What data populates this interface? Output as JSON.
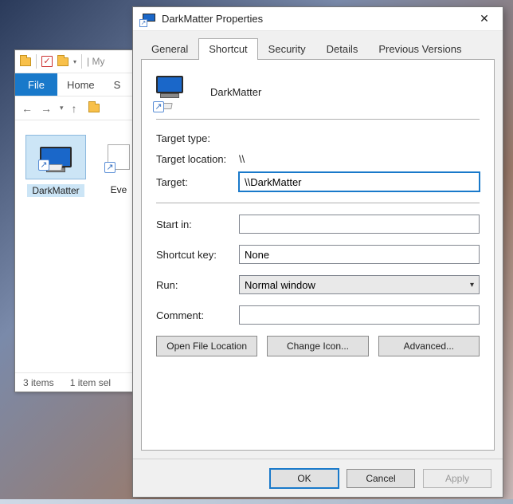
{
  "explorer": {
    "title_prefix": "| My",
    "file_tab": "File",
    "ribbon_tabs": [
      "Home",
      "S"
    ],
    "items": [
      {
        "label": "DarkMatter"
      },
      {
        "label": "Eve"
      }
    ],
    "status_items": "3 items",
    "status_selected": "1 item sel"
  },
  "dialog": {
    "title": "DarkMatter Properties",
    "tabs": [
      "General",
      "Shortcut",
      "Security",
      "Details",
      "Previous Versions"
    ],
    "active_tab_index": 1,
    "header_name": "DarkMatter",
    "fields": {
      "target_type_label": "Target type:",
      "target_type_value": "",
      "target_location_label": "Target location:",
      "target_location_value": "\\\\",
      "target_label": "Target:",
      "target_value": "\\\\DarkMatter",
      "start_in_label": "Start in:",
      "start_in_value": "",
      "shortcut_key_label": "Shortcut key:",
      "shortcut_key_value": "None",
      "run_label": "Run:",
      "run_value": "Normal window",
      "comment_label": "Comment:",
      "comment_value": ""
    },
    "buttons_mid": {
      "open_location": "Open File Location",
      "change_icon": "Change Icon...",
      "advanced": "Advanced..."
    },
    "buttons_bottom": {
      "ok": "OK",
      "cancel": "Cancel",
      "apply": "Apply"
    }
  }
}
